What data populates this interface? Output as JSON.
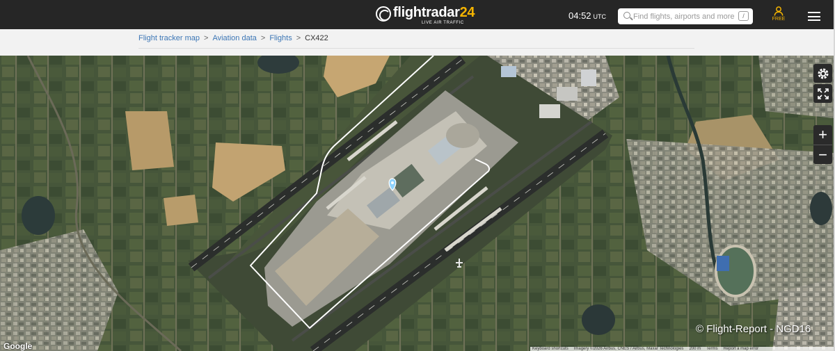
{
  "header": {
    "logo_text": "flightradar",
    "logo_number": "24",
    "logo_tagline": "LIVE AIR TRAFFIC",
    "time": "04:52",
    "time_zone": "UTC",
    "search_placeholder": "Find flights, airports and more",
    "search_shortcut": "/",
    "account_label": "FREE",
    "accent_color": "#f5b400"
  },
  "breadcrumb": {
    "items": [
      "Flight tracker map",
      "Aviation data",
      "Flights"
    ],
    "separator": ">",
    "current": "CX422"
  },
  "map": {
    "watermark": "© Flight-Report - NGD16",
    "provider": "Google",
    "attribution": [
      "Keyboard shortcuts",
      "Imagery ©2026 Airbus, CNES / Airbus, Maxar Technologies",
      "200 m",
      "Terms",
      "Report a map error"
    ],
    "controls": [
      "settings-icon",
      "expand-icon",
      "zoom-in-icon",
      "zoom-out-icon"
    ],
    "track_color": "#ffffff"
  }
}
